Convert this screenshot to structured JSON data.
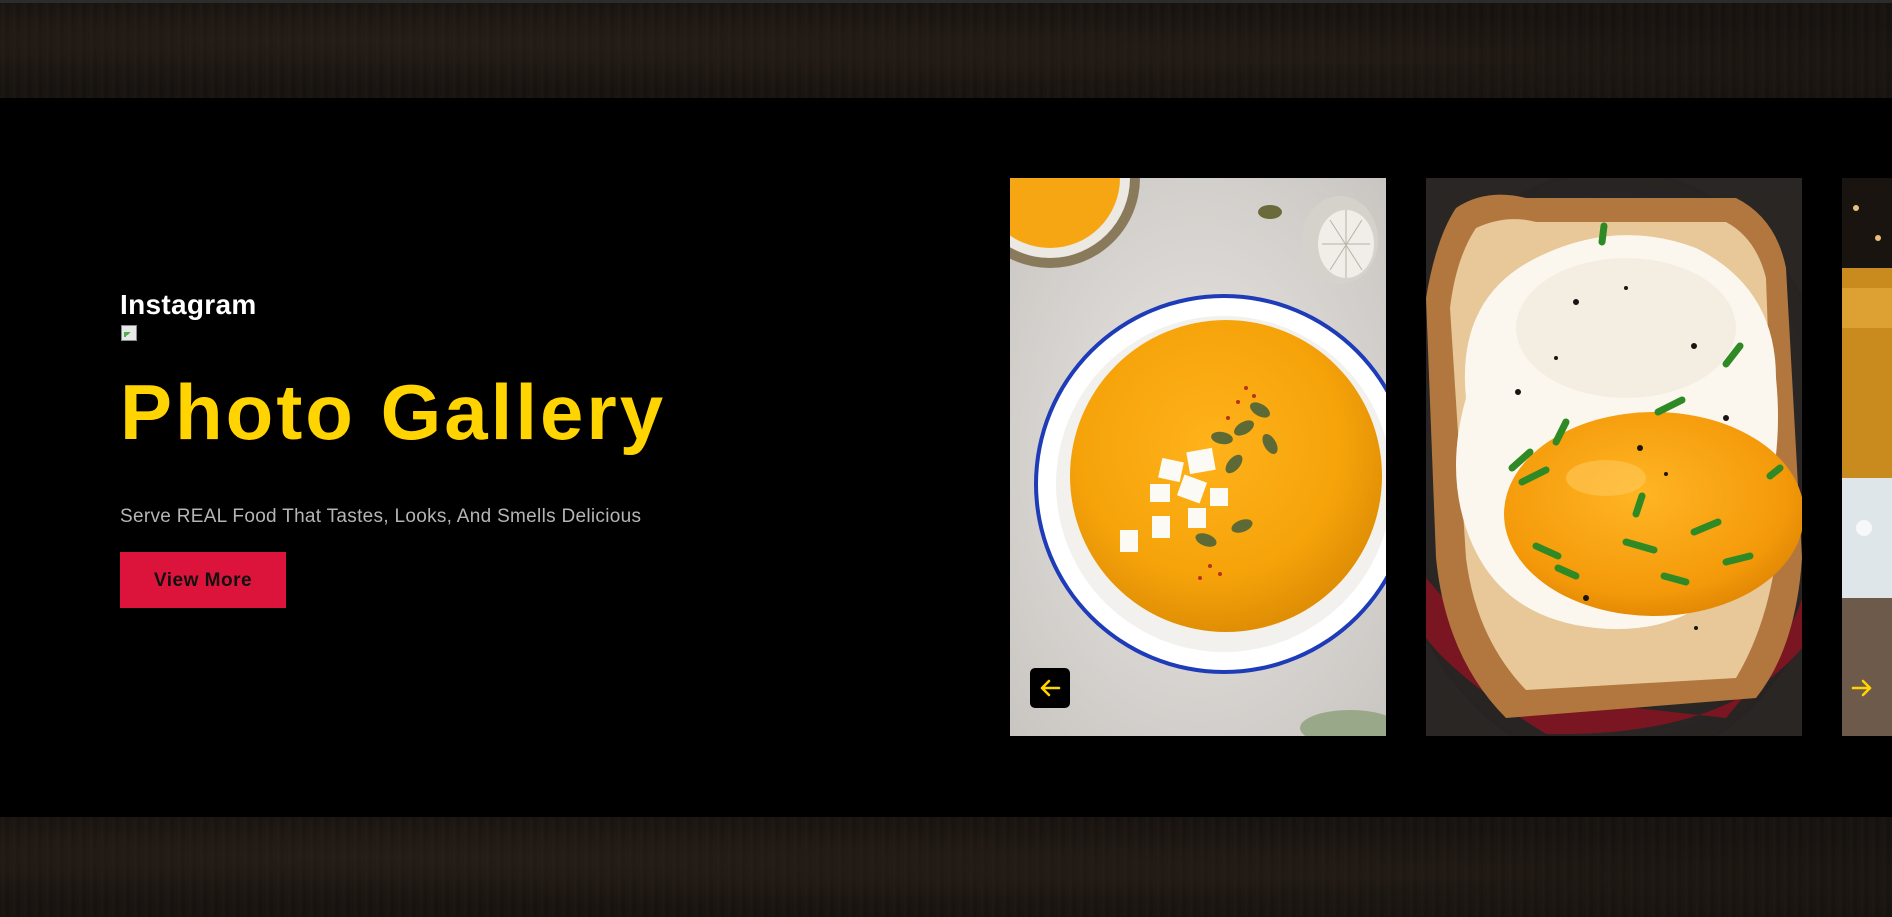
{
  "section": {
    "eyebrow": "Instagram",
    "heading": "Photo Gallery",
    "tagline": "Serve REAL Food That Tastes, Looks, And Smells Delicious",
    "cta_label": "View More"
  },
  "gallery": {
    "slides": [
      {
        "subject": "pumpkin-soup-bowl"
      },
      {
        "subject": "fried-egg-on-toast"
      },
      {
        "subject": "drink-with-ice"
      }
    ],
    "prev_icon": "arrow-left-icon",
    "next_icon": "arrow-right-icon"
  },
  "colors": {
    "accent_yellow": "#ffd400",
    "button_red": "#dc143c",
    "section_bg": "#000000"
  }
}
